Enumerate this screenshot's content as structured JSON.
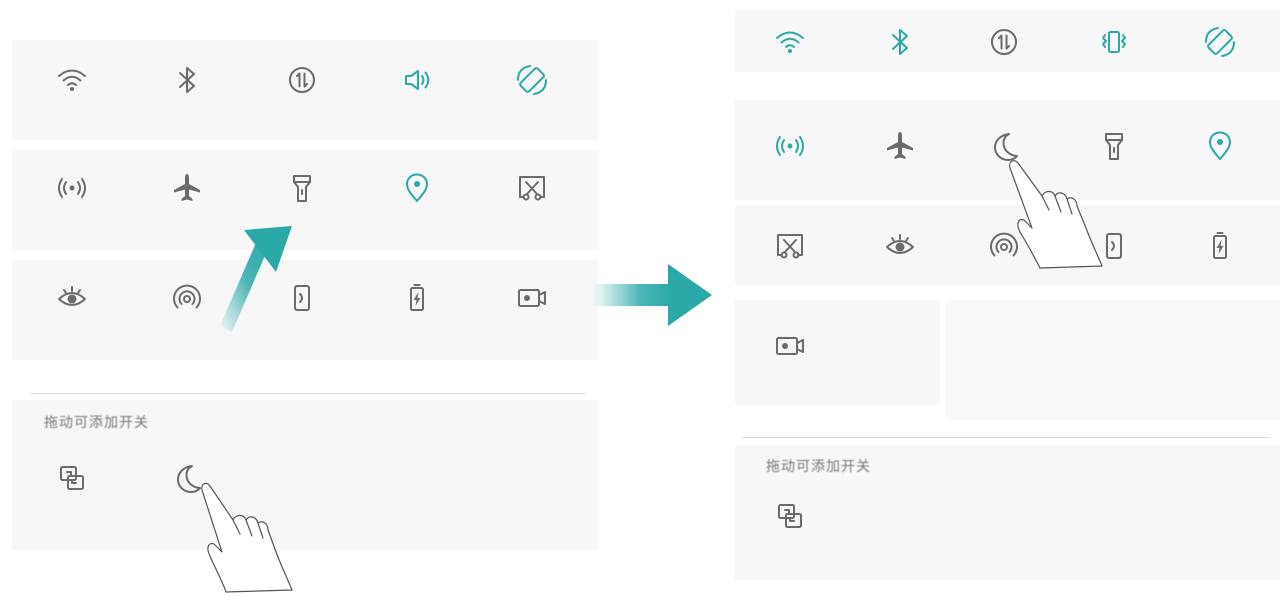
{
  "colors": {
    "active": "#2aa9a8",
    "inactive": "#6b6b6b",
    "arrow": "#2aa9a8"
  },
  "left_panel": {
    "row1": [
      {
        "icon": "wifi-icon",
        "active": false
      },
      {
        "icon": "bluetooth-icon",
        "active": false
      },
      {
        "icon": "mobile-data-icon",
        "active": false
      },
      {
        "icon": "sound-icon",
        "active": true
      },
      {
        "icon": "auto-rotate-icon",
        "active": true
      }
    ],
    "row2": [
      {
        "icon": "hotspot-icon",
        "active": false
      },
      {
        "icon": "airplane-icon",
        "active": false
      },
      {
        "icon": "flashlight-icon",
        "active": false
      },
      {
        "icon": "location-icon",
        "active": true
      },
      {
        "icon": "screenshot-icon",
        "active": false
      }
    ],
    "row3": [
      {
        "icon": "eye-comfort-icon",
        "active": false
      },
      {
        "icon": "nfc-icon",
        "active": false
      },
      {
        "icon": "screen-mirror-icon",
        "active": false
      },
      {
        "icon": "battery-saver-icon",
        "active": false
      },
      {
        "icon": "screen-recorder-icon",
        "active": false
      }
    ],
    "drag_hint": "拖动可添加开关",
    "available": [
      {
        "icon": "multi-screen-icon",
        "active": false
      },
      {
        "icon": "moon-icon",
        "active": false
      }
    ]
  },
  "right_panel": {
    "row1": [
      {
        "icon": "wifi-icon",
        "active": true
      },
      {
        "icon": "bluetooth-icon",
        "active": true
      },
      {
        "icon": "mobile-data-icon",
        "active": false
      },
      {
        "icon": "vibrate-icon",
        "active": true
      },
      {
        "icon": "auto-rotate-icon",
        "active": true
      }
    ],
    "row2": [
      {
        "icon": "hotspot-icon",
        "active": true
      },
      {
        "icon": "airplane-icon",
        "active": false
      },
      {
        "icon": "moon-icon",
        "active": false
      },
      {
        "icon": "flashlight-icon",
        "active": false
      },
      {
        "icon": "location-icon",
        "active": true
      }
    ],
    "row3": [
      {
        "icon": "screenshot-icon",
        "active": false
      },
      {
        "icon": "eye-comfort-icon",
        "active": false
      },
      {
        "icon": "nfc-icon",
        "active": false
      },
      {
        "icon": "screen-mirror-icon",
        "active": false
      },
      {
        "icon": "battery-saver-icon",
        "active": false
      }
    ],
    "row4": [
      {
        "icon": "screen-recorder-icon",
        "active": false
      }
    ],
    "drag_hint": "拖动可添加开关",
    "available": [
      {
        "icon": "multi-screen-icon",
        "active": false
      }
    ]
  }
}
